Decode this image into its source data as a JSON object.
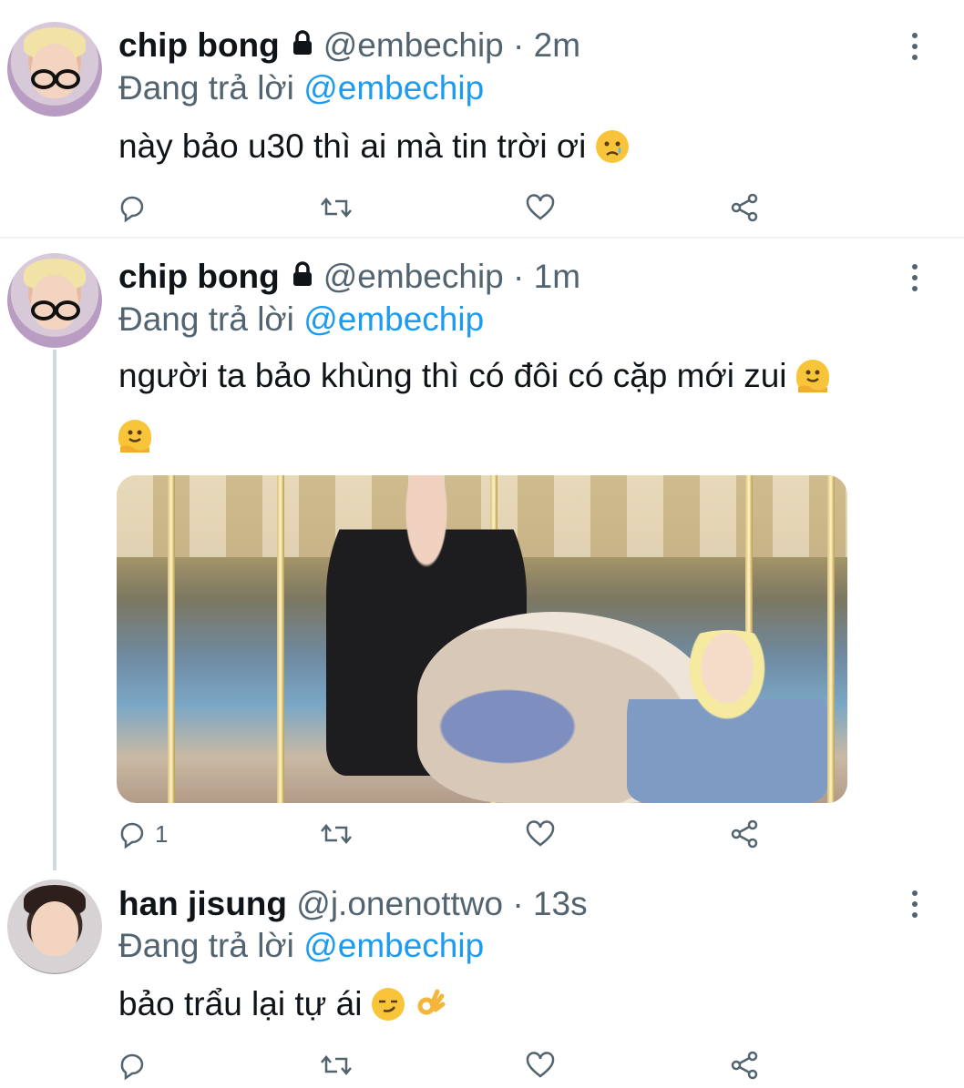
{
  "tweets": [
    {
      "name": "chip bong",
      "handle": "@embechip",
      "separator": "·",
      "time": "2m",
      "reply_prefix": "Đang trả lời",
      "reply_to": "@embechip",
      "text": "này bảo u30 thì ai mà tin trời ơi",
      "emojis": [
        "crying-face-emoji"
      ],
      "reply_count": "",
      "locked": true
    },
    {
      "name": "chip bong",
      "handle": "@embechip",
      "separator": "·",
      "time": "1m",
      "reply_prefix": "Đang trả lời",
      "reply_to": "@embechip",
      "text": "người ta bảo khùng thì có đôi có cặp mới zui",
      "emojis": [
        "melting-face-emoji",
        "melting-face-emoji"
      ],
      "reply_count": "1",
      "locked": true
    },
    {
      "name": "han jisung",
      "handle": "@j.onenottwo",
      "separator": "·",
      "time": "13s",
      "reply_prefix": "Đang trả lời",
      "reply_to": "@embechip",
      "text": "bảo trẩu lại tự ái",
      "emojis": [
        "smirking-face-emoji",
        "ok-hand-emoji"
      ],
      "reply_count": "",
      "locked": false
    }
  ],
  "icons": {
    "reply": "reply-icon",
    "retweet": "retweet-icon",
    "like": "heart-icon",
    "share": "share-icon",
    "more": "more-vertical-icon",
    "lock": "lock-icon"
  },
  "colors": {
    "text": "#0f1419",
    "secondary": "#536471",
    "link": "#1d9bf0",
    "divider": "#eff3f4",
    "thread_line": "#cfd9de"
  }
}
